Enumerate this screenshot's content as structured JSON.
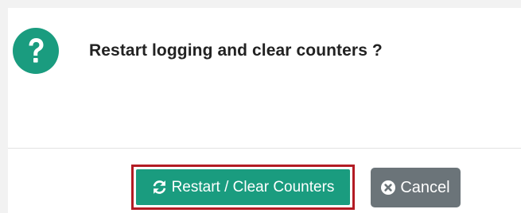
{
  "dialog": {
    "message": "Restart logging and clear counters ?",
    "icon": "question-circle-icon"
  },
  "footer": {
    "confirm_label": "Restart / Clear Counters",
    "confirm_icon": "refresh-icon",
    "cancel_label": "Cancel",
    "cancel_icon": "times-circle-icon"
  },
  "colors": {
    "accent": "#1a9c7f",
    "highlight_border": "#b31b24",
    "cancel_bg": "#6b7479",
    "text": "#222222"
  }
}
